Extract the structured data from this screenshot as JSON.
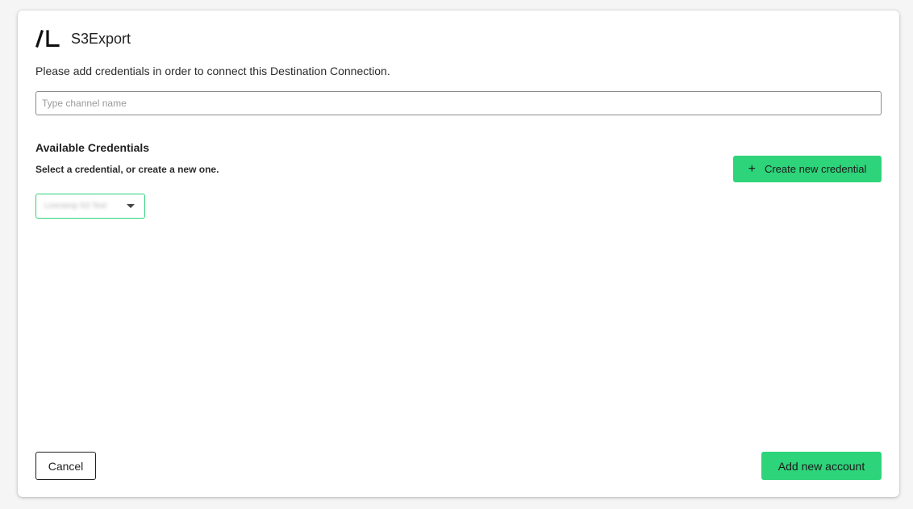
{
  "header": {
    "title": "S3Export",
    "logo_icon": "brand-logo-icon"
  },
  "intro_text": "Please add credentials in order to connect this Destination Connection.",
  "channel_input": {
    "value": "",
    "placeholder": "Type channel name"
  },
  "credentials": {
    "section_title": "Available Credentials",
    "section_subtitle": "Select a credential, or create a new one.",
    "create_button_label": "Create new credential",
    "create_button_icon": "plus-icon",
    "selected_value": "Liveramp S3 Test"
  },
  "footer": {
    "cancel_label": "Cancel",
    "add_label": "Add new account"
  },
  "colors": {
    "accent": "#2ed47a",
    "text": "#1f1f1f",
    "background": "#f5f5f5"
  }
}
